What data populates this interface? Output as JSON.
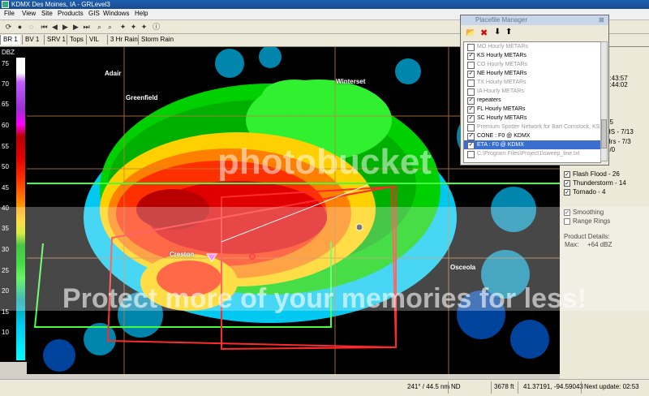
{
  "window": {
    "title": "KDMX Des Moines, IA - GRLevel3"
  },
  "menu": [
    "File",
    "View",
    "Site",
    "Products",
    "GIS",
    "Windows",
    "Help"
  ],
  "tabs": [
    "BR 1",
    "BV 1",
    "SRV 1",
    "Tops",
    "VIL",
    "3 Hr Rain",
    "Storm Rain"
  ],
  "legend": {
    "unit": "DBZ",
    "labels": [
      "75",
      "70",
      "65",
      "60",
      "55",
      "50",
      "45",
      "40",
      "35",
      "30",
      "25",
      "20",
      "15",
      "10"
    ]
  },
  "cities": [
    "Adair",
    "Greenfield",
    "Winterset",
    "Creston",
    "Osceola"
  ],
  "popup": {
    "title": "Placefile Manager",
    "items": [
      {
        "label": "MO Hourly METARs",
        "checked": false,
        "gray": true
      },
      {
        "label": "KS Hourly METARs",
        "checked": true,
        "gray": false
      },
      {
        "label": "CO Hourly METARs",
        "checked": false,
        "gray": true
      },
      {
        "label": "NE Hourly METARs",
        "checked": true,
        "gray": false
      },
      {
        "label": "TX Hourly METARs",
        "checked": false,
        "gray": true
      },
      {
        "label": "IA Hourly METARs",
        "checked": false,
        "gray": true
      },
      {
        "label": "repeaters",
        "checked": true,
        "gray": false
      },
      {
        "label": "FL Hourly METARs",
        "checked": true,
        "gray": false
      },
      {
        "label": "SC Hourly METARs",
        "checked": true,
        "gray": false
      },
      {
        "label": "Premium Spotter Network for Bart Comstock, KS",
        "checked": false,
        "gray": true
      },
      {
        "label": "CONE : F0 @ KDMX",
        "checked": true,
        "gray": false
      },
      {
        "label": "ETA : F0 @ KDMX",
        "checked": true,
        "gray": false,
        "selected": true
      },
      {
        "label": "C:\\Program Files\\Project1\\sweep_line.txt",
        "checked": false,
        "gray": true
      }
    ]
  },
  "right_panel": {
    "times": [
      "2:43:57",
      "2:44:02"
    ],
    "counts": [
      "35",
      "HS - 7/13",
      "Hrs - 7/3",
      "0/0"
    ],
    "warnings": [
      {
        "label": "Flash Flood - 26",
        "checked": true
      },
      {
        "label": "Thunderstorm - 14",
        "checked": true
      },
      {
        "label": "Tornado - 4",
        "checked": true
      }
    ],
    "options": [
      {
        "label": "Smoothing",
        "checked": true
      },
      {
        "label": "Range Rings",
        "checked": false
      }
    ],
    "product_details_title": "Product Details:",
    "max_label": "Max:",
    "max_value": "+64 dBZ"
  },
  "status": {
    "azimuth": "241° / 44.5 nm",
    "nd": "ND",
    "height": "3678 ft",
    "coords": "41.37191, -94.59043",
    "next_update": "Next update: 02:53"
  },
  "watermark": {
    "line1": "photobucket",
    "line2": "Protect more of your memories for less!"
  },
  "colors": {
    "titlebar": "#1f5fb0",
    "selected": "#3a6fd0",
    "warning_box": "#ff2a2a"
  }
}
